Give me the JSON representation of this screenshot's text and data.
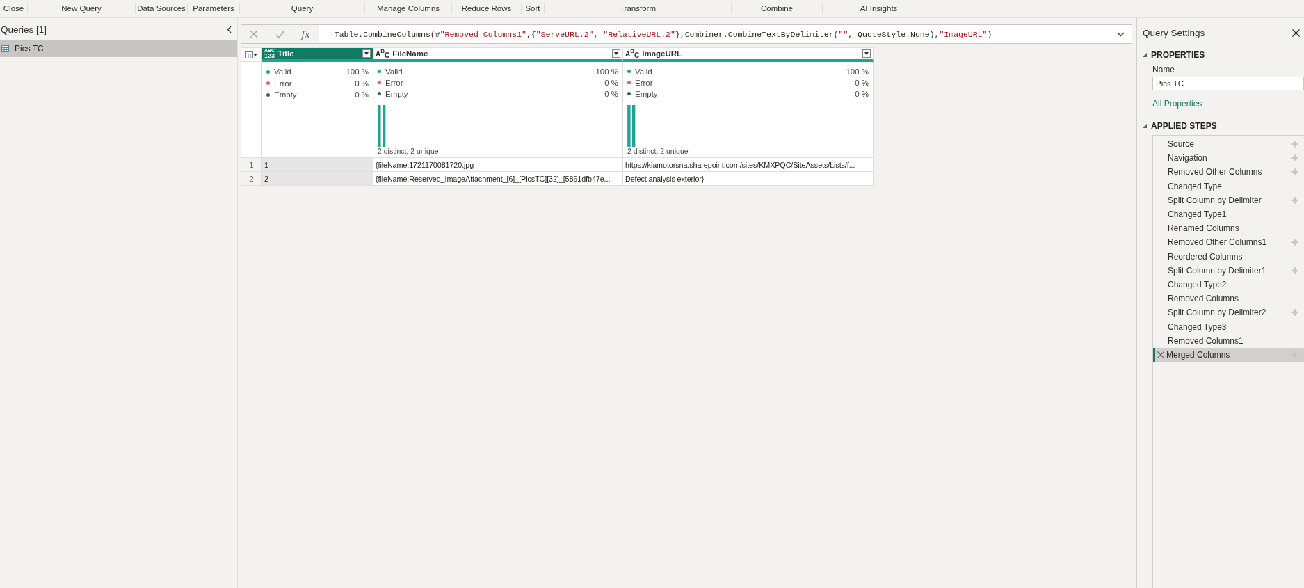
{
  "ribbon": {
    "groups": [
      "Close",
      "New Query",
      "Data Sources",
      "Parameters",
      "Query",
      "Manage Columns",
      "Reduce Rows",
      "Sort",
      "Transform",
      "Combine",
      "AI Insights"
    ]
  },
  "queries_panel": {
    "title": "Queries [1]",
    "items": [
      {
        "name": "Pics TC",
        "selected": true
      }
    ]
  },
  "formula_bar": {
    "fx_label": "fx",
    "formula": "= Table.CombineColumns(#\"Removed Columns1\",{\"ServeURL.2\", \"RelativeURL.2\"},Combiner.CombineTextByDelimiter(\"\", QuoteStyle.None),\"ImageURL\")"
  },
  "table": {
    "columns": [
      {
        "name": "Title",
        "kind": "any",
        "type_glyph": [
          "ABC",
          "123"
        ],
        "selected": true,
        "stats": [
          {
            "label": "Valid",
            "value": "100 %"
          },
          {
            "label": "Error",
            "value": "0 %"
          },
          {
            "label": "Empty",
            "value": "0 %"
          }
        ]
      },
      {
        "name": "FileName",
        "kind": "text",
        "type_glyph": [
          "A",
          "B",
          "C"
        ],
        "selected": false,
        "stats": [
          {
            "label": "Valid",
            "value": "100 %"
          },
          {
            "label": "Error",
            "value": "0 %"
          },
          {
            "label": "Empty",
            "value": "0 %"
          }
        ],
        "distribution_note": "2 distinct, 2 unique"
      },
      {
        "name": "ImageURL",
        "kind": "text",
        "type_glyph": [
          "A",
          "B",
          "C"
        ],
        "selected": false,
        "stats": [
          {
            "label": "Valid",
            "value": "100 %"
          },
          {
            "label": "Error",
            "value": "0 %"
          },
          {
            "label": "Empty",
            "value": "0 %"
          }
        ],
        "distribution_note": "2 distinct, 2 unique"
      }
    ],
    "rows": [
      {
        "index": "1",
        "cells": [
          "1",
          "{fileName:1721170081720.jpg",
          "https://kiamotorsna.sharepoint.com/sites/KMXPQC/SiteAssets/Lists/f..."
        ]
      },
      {
        "index": "2",
        "cells": [
          "2",
          "{fileName:Reserved_ImageAttachment_[6]_[PicsTC][32]_[5861dfb47e...",
          "Defect analysis exterior}"
        ]
      }
    ]
  },
  "query_settings": {
    "title": "Query Settings",
    "properties_heading": "PROPERTIES",
    "name_label": "Name",
    "name_value": "Pics TC",
    "all_properties_link": "All Properties",
    "steps_heading": "APPLIED STEPS",
    "steps": [
      {
        "name": "Source",
        "has_settings": true,
        "selected": false
      },
      {
        "name": "Navigation",
        "has_settings": true,
        "selected": false
      },
      {
        "name": "Removed Other Columns",
        "has_settings": true,
        "selected": false
      },
      {
        "name": "Changed Type",
        "has_settings": false,
        "selected": false
      },
      {
        "name": "Split Column by Delimiter",
        "has_settings": true,
        "selected": false
      },
      {
        "name": "Changed Type1",
        "has_settings": false,
        "selected": false
      },
      {
        "name": "Renamed Columns",
        "has_settings": false,
        "selected": false
      },
      {
        "name": "Removed Other Columns1",
        "has_settings": true,
        "selected": false
      },
      {
        "name": "Reordered Columns",
        "has_settings": false,
        "selected": false
      },
      {
        "name": "Split Column by Delimiter1",
        "has_settings": true,
        "selected": false
      },
      {
        "name": "Changed Type2",
        "has_settings": false,
        "selected": false
      },
      {
        "name": "Removed Columns",
        "has_settings": false,
        "selected": false
      },
      {
        "name": "Split Column by Delimiter2",
        "has_settings": true,
        "selected": false
      },
      {
        "name": "Changed Type3",
        "has_settings": false,
        "selected": false
      },
      {
        "name": "Removed Columns1",
        "has_settings": false,
        "selected": false
      },
      {
        "name": "Merged Columns",
        "has_settings": true,
        "selected": true
      }
    ]
  }
}
